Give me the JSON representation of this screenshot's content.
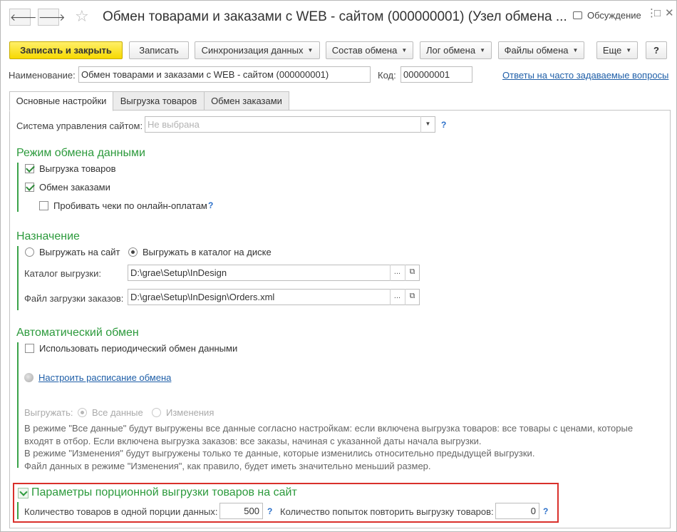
{
  "window": {
    "title": "Обмен товарами и заказами с WEB - сайтом (000000001) (Узел обмена ...",
    "discussion_label": "Обсуждение",
    "nav_back": "🡐",
    "nav_forward": "🡒",
    "star": "☆",
    "more_icon": "⋮",
    "restore_icon": "□",
    "close_icon": "✕"
  },
  "toolbar": {
    "save_close": "Записать и закрыть",
    "save": "Записать",
    "sync": "Синхронизация данных",
    "composition": "Состав обмена",
    "log": "Лог обмена",
    "files": "Файлы обмена",
    "more": "Еще",
    "help": "?",
    "dropdown_arrow": "▼"
  },
  "header": {
    "name_label": "Наименование:",
    "name_value": "Обмен товарами и заказами с WEB - сайтом (000000001)",
    "code_label": "Код:",
    "code_value": "000000001",
    "faq_link": "Ответы на часто задаваемые вопросы"
  },
  "tabs": [
    {
      "label": "Основные настройки",
      "active": true
    },
    {
      "label": "Выгрузка товаров",
      "active": false
    },
    {
      "label": "Обмен заказами",
      "active": false
    }
  ],
  "cms": {
    "label": "Система управления сайтом:",
    "placeholder": "Не выбрана",
    "help": "?"
  },
  "exchange_mode": {
    "title": "Режим обмена данными",
    "export_goods": {
      "label": "Выгрузка товаров",
      "checked": true
    },
    "exchange_orders": {
      "label": "Обмен заказами",
      "checked": true
    },
    "punch_receipts": {
      "label": "Пробивать чеки по онлайн-оплатам",
      "checked": false
    },
    "help": "?"
  },
  "destination": {
    "title": "Назначение",
    "to_site": {
      "label": "Выгружать на сайт",
      "selected": false
    },
    "to_disk": {
      "label": "Выгружать в каталог на диске",
      "selected": true
    },
    "dir_label": "Каталог выгрузки:",
    "dir_value": "D:\\grae\\Setup\\InDesign",
    "orders_file_label": "Файл загрузки заказов:",
    "orders_file_value": "D:\\grae\\Setup\\InDesign\\Orders.xml",
    "ellipsis": "...",
    "open_icon": "⧉"
  },
  "auto_exchange": {
    "title": "Автоматический обмен",
    "periodic": {
      "label": "Использовать периодический обмен данными",
      "checked": false
    },
    "schedule_link": "Настроить расписание обмена",
    "export_label": "Выгружать:",
    "all_data": {
      "label": "Все данные",
      "selected": true
    },
    "changes": {
      "label": "Изменения",
      "selected": false
    },
    "description": [
      "В режиме \"Все данные\" будут выгружены все данные согласно настройкам: если включена выгрузка товаров: все товары с ценами, которые",
      "входят в отбор. Если включена выгрузка заказов: все заказы, начиная с указанной даты начала выгрузки.",
      "В режиме \"Изменения\" будут выгружены только те данные, которые изменились относительно предыдущей выгрузки.",
      "Файл данных в режиме \"Изменения\", как правило, будет иметь значительно меньший размер."
    ]
  },
  "batch": {
    "title": "Параметры порционной выгрузки товаров на сайт",
    "portion_label": "Количество товаров в одной порции данных:",
    "portion_value": "500",
    "retry_label": "Количество попыток повторить выгрузку товаров:",
    "retry_value": "0",
    "help": "?"
  },
  "colors": {
    "accent_green": "#2c9a3c",
    "primary_button": "#f7d900",
    "link": "#1f5fa8",
    "highlight_red": "#d9302b"
  }
}
